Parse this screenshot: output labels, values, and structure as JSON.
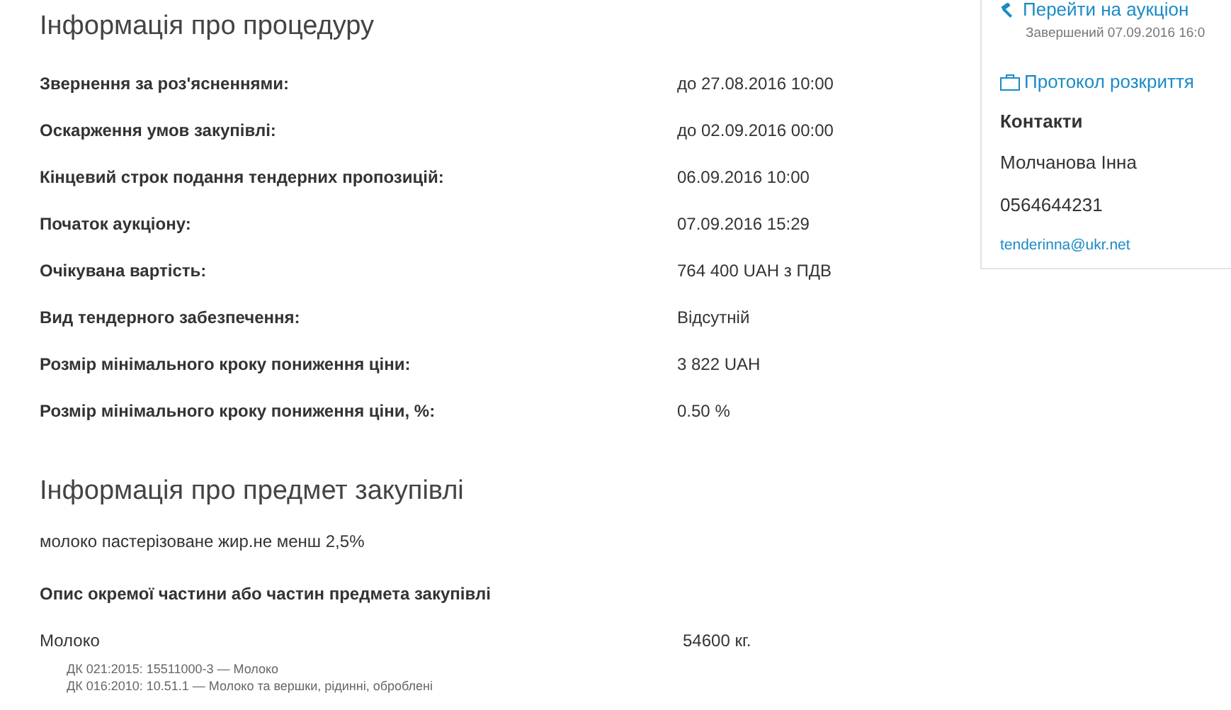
{
  "procedure": {
    "title": "Інформація про процедуру",
    "rows": [
      {
        "label": "Звернення за роз'ясненнями:",
        "value": "до 27.08.2016 10:00"
      },
      {
        "label": "Оскарження умов закупівлі:",
        "value": "до 02.09.2016 00:00"
      },
      {
        "label": "Кінцевий строк подання тендерних пропозицій:",
        "value": "06.09.2016 10:00"
      },
      {
        "label": "Початок аукціону:",
        "value": "07.09.2016 15:29"
      },
      {
        "label": "Очікувана вартість:",
        "value": "764 400 UAH з ПДВ"
      },
      {
        "label": "Вид тендерного забезпечення:",
        "value": "Відсутній"
      },
      {
        "label": "Розмір мінімального кроку пониження ціни:",
        "value": "3 822 UAH"
      },
      {
        "label": "Розмір мінімального кроку пониження ціни, %:",
        "value": "0.50 %"
      }
    ]
  },
  "subject": {
    "title": "Інформація про предмет закупівлі",
    "description": "молоко пастерізоване жир.не менш 2,5%",
    "lots_heading": "Опис окремої частини або частин предмета закупівлі",
    "items": [
      {
        "name": "Молоко",
        "quantity": "54600 кг.",
        "codes": [
          "ДК 021:2015: 15511000-3 — Молоко",
          "ДК 016:2010: 10.51.1 — Молоко та вершки, рідинні, оброблені"
        ]
      }
    ]
  },
  "sidebar": {
    "auction_link": "Перейти на аукціон",
    "auction_status": "Завершений 07.09.2016 16:0",
    "protocol_link": "Протокол розкриття",
    "contacts_heading": "Контакти",
    "contact_name": "Молчанова Інна",
    "phone": "0564644231",
    "email": "tenderinna@ukr.net"
  }
}
